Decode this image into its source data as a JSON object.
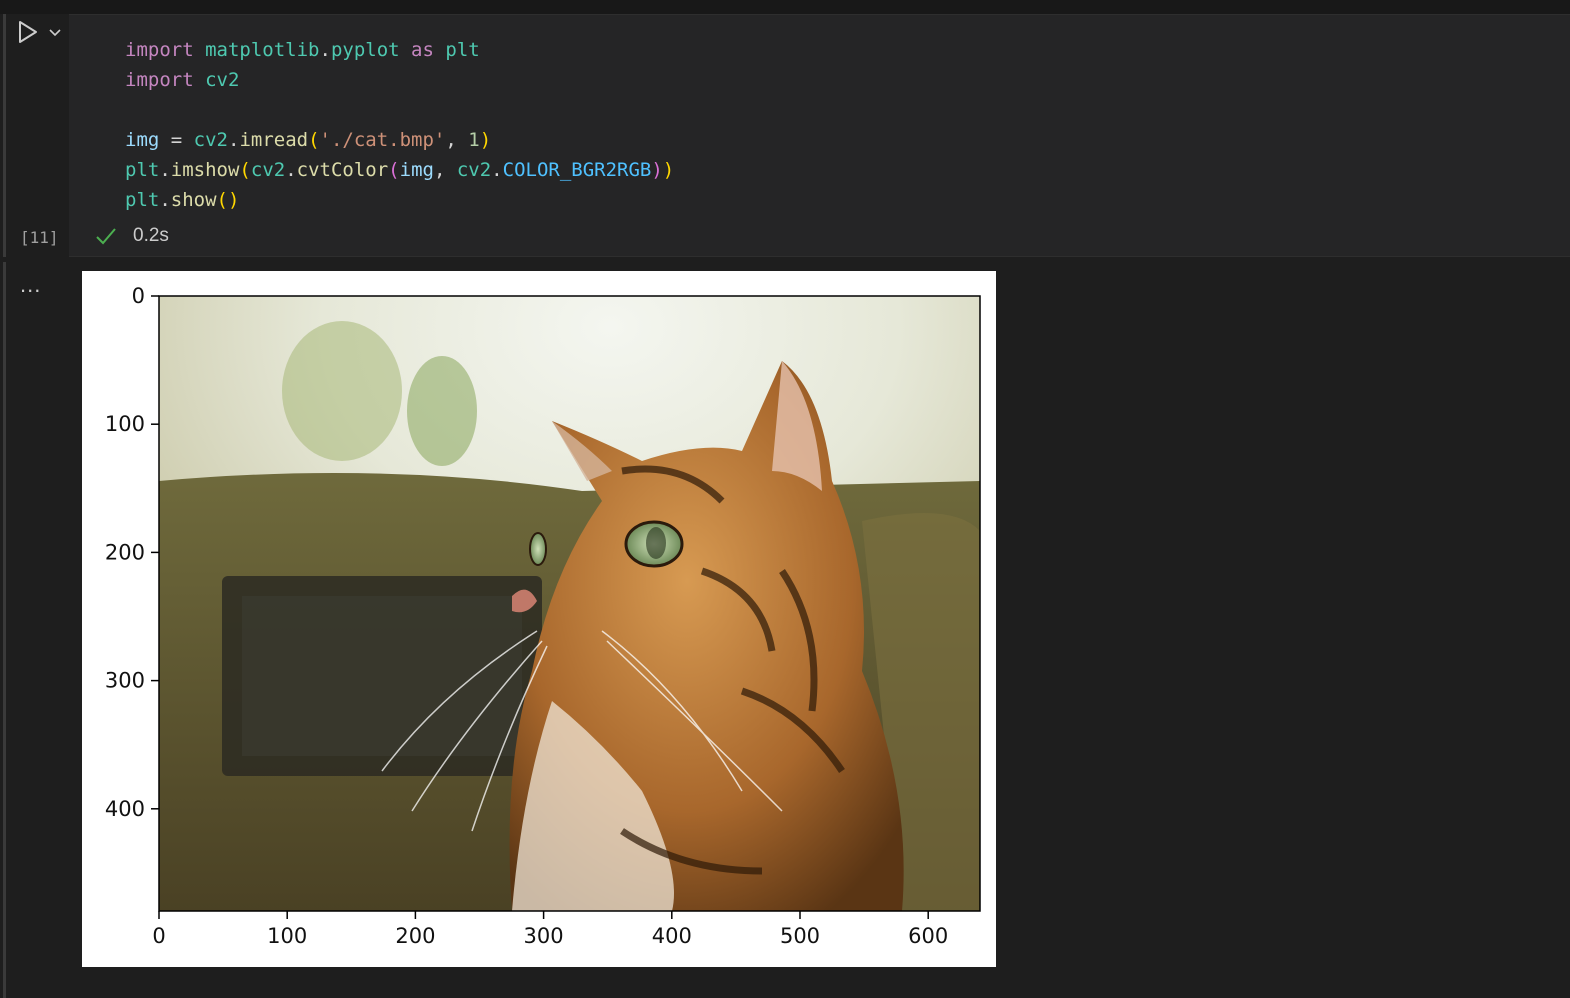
{
  "cell": {
    "execution_count": "[11]",
    "status_time": "0.2s",
    "code_lines": [
      "import matplotlib.pyplot as plt",
      "import cv2",
      "",
      "img = cv2.imread('./cat.bmp', 1)",
      "plt.imshow(cv2.cvtColor(img, cv2.COLOR_BGR2RGB))",
      "plt.show()"
    ]
  },
  "output": {
    "more_label": "...",
    "figure": {
      "y_tick_labels": [
        "0",
        "100",
        "200",
        "300",
        "400"
      ],
      "x_tick_labels": [
        "0",
        "100",
        "200",
        "300",
        "400",
        "500",
        "600"
      ],
      "image_subject": "cat"
    }
  },
  "icons": {
    "run": "play-icon",
    "run_menu": "chevron-down-icon",
    "status": "check-icon"
  },
  "colors": {
    "background": "#1e1e1e",
    "cell_background": "#252526",
    "success_check": "#4caf50"
  }
}
